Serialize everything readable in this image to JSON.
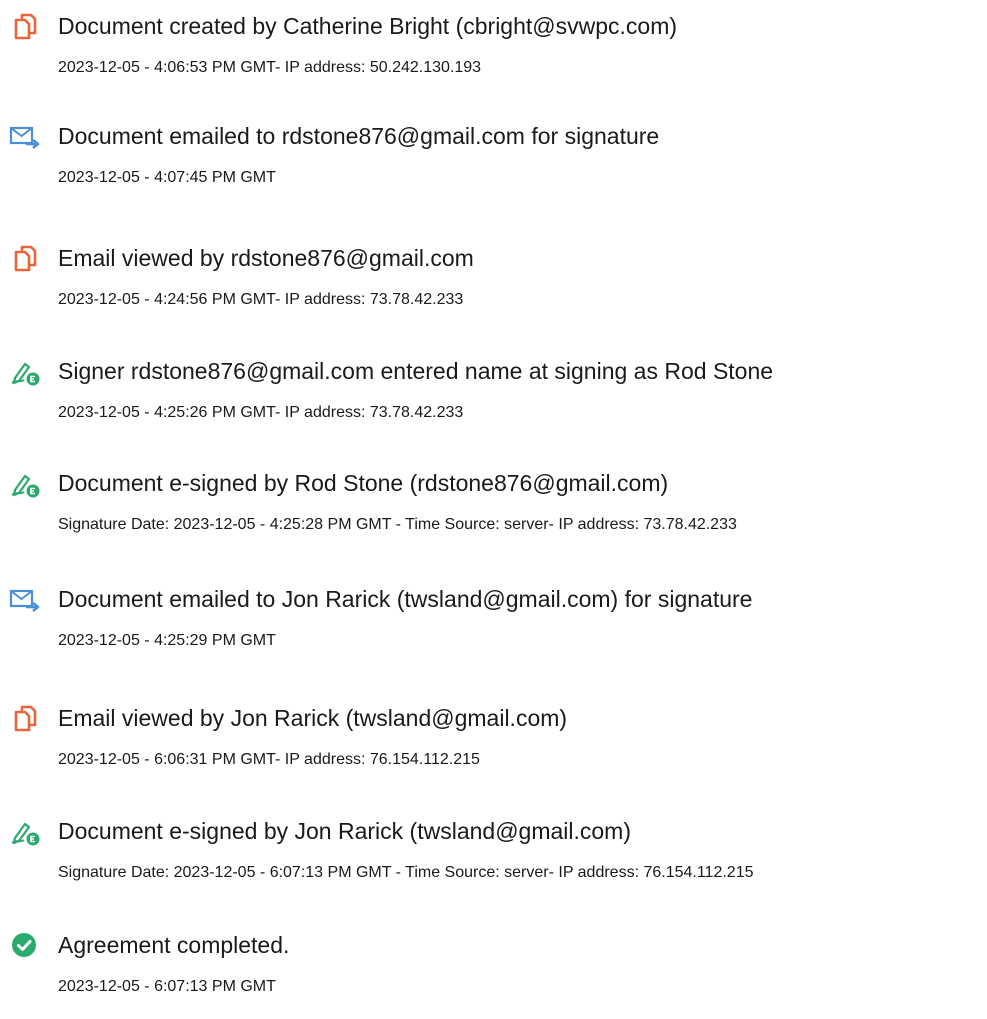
{
  "colors": {
    "doc_icon": "#E8643A",
    "email_icon": "#4A90D9",
    "sign_icon": "#2BAA6E",
    "complete_icon": "#2BAA6E",
    "text": "#1A1A1A"
  },
  "events": [
    {
      "icon": "document-icon",
      "title": "Document created by Catherine Bright (cbright@svwpc.com)",
      "detail": "2023-12-05 - 4:06:53 PM GMT- IP address: 50.242.130.193"
    },
    {
      "icon": "email-icon",
      "title": "Document emailed to rdstone876@gmail.com for signature",
      "detail": "2023-12-05 - 4:07:45 PM GMT"
    },
    {
      "icon": "document-icon",
      "title": "Email viewed by rdstone876@gmail.com",
      "detail": "2023-12-05 - 4:24:56 PM GMT- IP address: 73.78.42.233"
    },
    {
      "icon": "signature-pen-icon",
      "title": "Signer rdstone876@gmail.com entered name at signing as Rod Stone",
      "detail": "2023-12-05 - 4:25:26 PM GMT- IP address: 73.78.42.233"
    },
    {
      "icon": "signature-pen-icon",
      "title": "Document e-signed by Rod Stone (rdstone876@gmail.com)",
      "detail": "Signature Date: 2023-12-05 - 4:25:28 PM GMT - Time Source: server- IP address: 73.78.42.233"
    },
    {
      "icon": "email-icon",
      "title": "Document emailed to Jon Rarick (twsland@gmail.com) for signature",
      "detail": "2023-12-05 - 4:25:29 PM GMT"
    },
    {
      "icon": "document-icon",
      "title": "Email viewed by Jon Rarick (twsland@gmail.com)",
      "detail": "2023-12-05 - 6:06:31 PM GMT- IP address: 76.154.112.215"
    },
    {
      "icon": "signature-pen-icon",
      "title": "Document e-signed by Jon Rarick (twsland@gmail.com)",
      "detail": "Signature Date: 2023-12-05 - 6:07:13 PM GMT - Time Source: server- IP address: 76.154.112.215"
    },
    {
      "icon": "checkmark-circle-icon",
      "title": "Agreement completed.",
      "detail": "2023-12-05 - 6:07:13 PM GMT"
    }
  ]
}
